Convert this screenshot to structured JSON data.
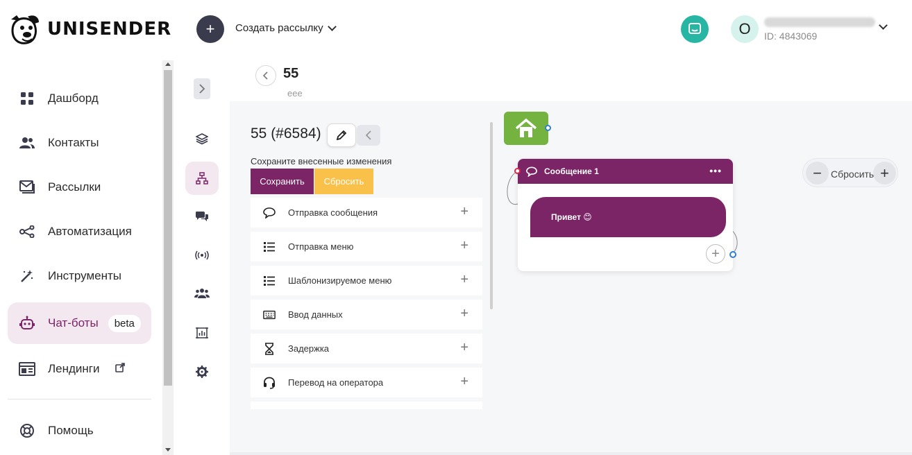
{
  "brand": {
    "name": "UNISENDER"
  },
  "header": {
    "create_button": "+",
    "create_label": "Создать рассылку",
    "account_initial": "O",
    "account_id": "ID: 4843069"
  },
  "sidebar": {
    "items": [
      {
        "label": "Дашборд",
        "icon": "dashboard-icon"
      },
      {
        "label": "Контакты",
        "icon": "contacts-icon"
      },
      {
        "label": "Рассылки",
        "icon": "mail-icon"
      },
      {
        "label": "Автоматизация",
        "icon": "automation-icon"
      },
      {
        "label": "Инструменты",
        "icon": "magic-wand-icon"
      },
      {
        "label": "Чат-боты",
        "icon": "robot-icon",
        "badge": "beta",
        "active": true
      },
      {
        "label": "Лендинги",
        "icon": "landing-icon"
      },
      {
        "label": "Помощь",
        "icon": "help-icon"
      }
    ]
  },
  "page": {
    "title": "55",
    "subtitle": "eee"
  },
  "editor": {
    "bot_name": "55 (#6584)",
    "save_hint": "Сохраните внесенные изменения",
    "save_label": "Сохранить",
    "reset_label": "Сбросить",
    "blocks": [
      {
        "label": "Отправка сообщения",
        "icon": "speech-bubble-icon"
      },
      {
        "label": "Отправка меню",
        "icon": "list-icon"
      },
      {
        "label": "Шаблонизируемое меню",
        "icon": "list-icon"
      },
      {
        "label": "Ввод данных",
        "icon": "keyboard-icon"
      },
      {
        "label": "Задержка",
        "icon": "hourglass-icon"
      },
      {
        "label": "Перевод на оператора",
        "icon": "headset-icon"
      }
    ]
  },
  "canvas": {
    "message_node": {
      "title": "Сообщение 1",
      "text": "Привет 😊"
    },
    "zoom": {
      "minus": "−",
      "reset_label": "Сбросить",
      "plus": "+"
    }
  },
  "colors": {
    "accent": "#7b2466",
    "accent_soft": "#f3e7f0",
    "reset": "#f9c14a",
    "start_node": "#74b33f",
    "chat": "#27b5a4"
  }
}
